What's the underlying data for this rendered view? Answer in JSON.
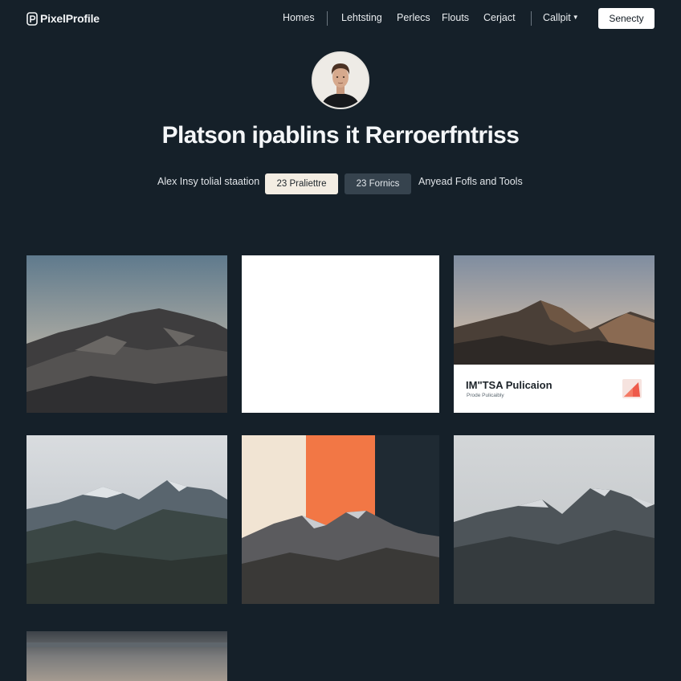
{
  "header": {
    "logo_text": "PixelProfile",
    "nav": [
      "Homes",
      "Lehtsting",
      "Perlecs",
      "Flouts",
      "Cerjact",
      "Callpit"
    ],
    "cta_label": "Senecty"
  },
  "profile": {
    "title": "Platson ipablins it Rerroerfntriss",
    "meta_left": "Alex Insy tolial staation",
    "chip_primary": "23 Praliettre",
    "chip_secondary": "23 Fornics",
    "meta_right": "Anyead Fofls and Tools"
  },
  "gallery": {
    "featured_card": {
      "title": "IM\"TSA Pulicaion",
      "subtitle": "Prode Pulicaibly"
    }
  },
  "colors": {
    "background": "#152029",
    "accent": "#f27745",
    "button": "#ffffff"
  }
}
